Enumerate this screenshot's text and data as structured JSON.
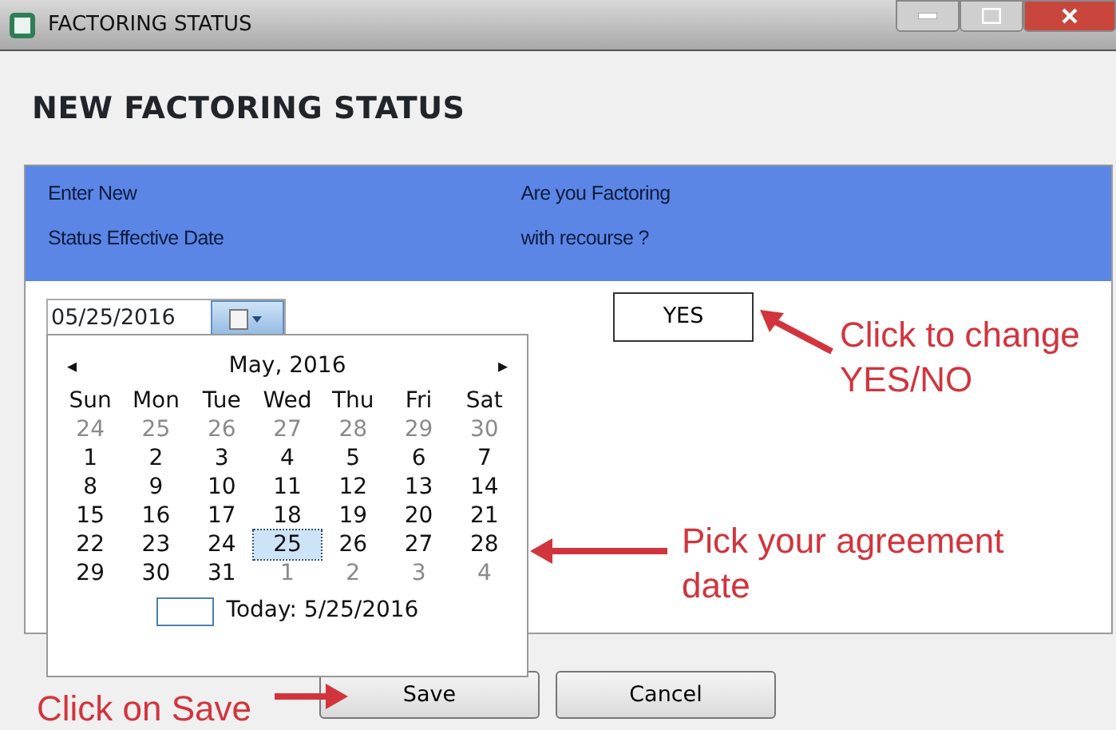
{
  "window": {
    "title": "FACTORING STATUS"
  },
  "heading": "NEW FACTORING STATUS",
  "columns": [
    {
      "lines": [
        "Enter New",
        "Status Effective Date"
      ]
    },
    {
      "lines": [
        "Are you Factoring",
        "with recourse ?"
      ]
    }
  ],
  "date_field": {
    "value": "05/25/2016"
  },
  "toggle": {
    "value": "YES"
  },
  "calendar": {
    "month": "May, 2016",
    "prev": "◂",
    "next": "▸",
    "weekdays": [
      "Sun",
      "Mon",
      "Tue",
      "Wed",
      "Thu",
      "Fri",
      "Sat"
    ],
    "days": [
      {
        "day": "24",
        "other_month": true,
        "selected": false
      },
      {
        "day": "25",
        "other_month": true,
        "selected": false
      },
      {
        "day": "26",
        "other_month": true,
        "selected": false
      },
      {
        "day": "27",
        "other_month": true,
        "selected": false
      },
      {
        "day": "28",
        "other_month": true,
        "selected": false
      },
      {
        "day": "29",
        "other_month": true,
        "selected": false
      },
      {
        "day": "30",
        "other_month": true,
        "selected": false
      },
      {
        "day": "1",
        "other_month": false,
        "selected": false
      },
      {
        "day": "2",
        "other_month": false,
        "selected": false
      },
      {
        "day": "3",
        "other_month": false,
        "selected": false
      },
      {
        "day": "4",
        "other_month": false,
        "selected": false
      },
      {
        "day": "5",
        "other_month": false,
        "selected": false
      },
      {
        "day": "6",
        "other_month": false,
        "selected": false
      },
      {
        "day": "7",
        "other_month": false,
        "selected": false
      },
      {
        "day": "8",
        "other_month": false,
        "selected": false
      },
      {
        "day": "9",
        "other_month": false,
        "selected": false
      },
      {
        "day": "10",
        "other_month": false,
        "selected": false
      },
      {
        "day": "11",
        "other_month": false,
        "selected": false
      },
      {
        "day": "12",
        "other_month": false,
        "selected": false
      },
      {
        "day": "13",
        "other_month": false,
        "selected": false
      },
      {
        "day": "14",
        "other_month": false,
        "selected": false
      },
      {
        "day": "15",
        "other_month": false,
        "selected": false
      },
      {
        "day": "16",
        "other_month": false,
        "selected": false
      },
      {
        "day": "17",
        "other_month": false,
        "selected": false
      },
      {
        "day": "18",
        "other_month": false,
        "selected": false
      },
      {
        "day": "19",
        "other_month": false,
        "selected": false
      },
      {
        "day": "20",
        "other_month": false,
        "selected": false
      },
      {
        "day": "21",
        "other_month": false,
        "selected": false
      },
      {
        "day": "22",
        "other_month": false,
        "selected": false
      },
      {
        "day": "23",
        "other_month": false,
        "selected": false
      },
      {
        "day": "24",
        "other_month": false,
        "selected": false
      },
      {
        "day": "25",
        "other_month": false,
        "selected": true
      },
      {
        "day": "26",
        "other_month": false,
        "selected": false
      },
      {
        "day": "27",
        "other_month": false,
        "selected": false
      },
      {
        "day": "28",
        "other_month": false,
        "selected": false
      },
      {
        "day": "29",
        "other_month": false,
        "selected": false
      },
      {
        "day": "30",
        "other_month": false,
        "selected": false
      },
      {
        "day": "31",
        "other_month": false,
        "selected": false
      },
      {
        "day": "1",
        "other_month": true,
        "selected": false
      },
      {
        "day": "2",
        "other_month": true,
        "selected": false
      },
      {
        "day": "3",
        "other_month": true,
        "selected": false
      },
      {
        "day": "4",
        "other_month": true,
        "selected": false
      }
    ],
    "today": "Today: 5/25/2016"
  },
  "buttons": [
    "Save",
    "Cancel"
  ],
  "annotations": [
    {
      "lines": [
        "Click to change",
        "YES/NO"
      ]
    },
    {
      "lines": [
        "Pick your agreement",
        "date"
      ]
    },
    {
      "lines": [
        "Click on Save"
      ]
    }
  ]
}
